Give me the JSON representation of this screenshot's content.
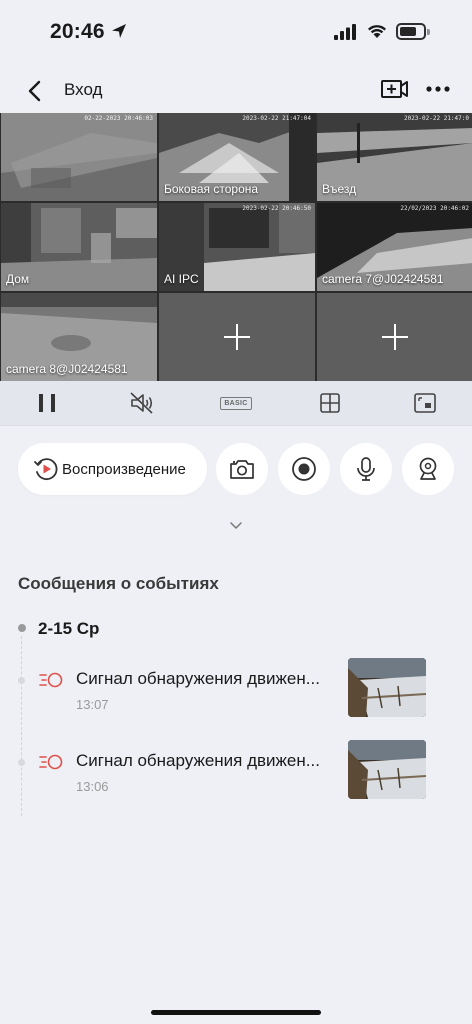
{
  "status_bar": {
    "time": "20:46"
  },
  "nav": {
    "title": "Вход"
  },
  "cameras": [
    {
      "label": "",
      "timestamp": "02-22-2023 20:46:03",
      "selected": true
    },
    {
      "label": "Боковая сторона",
      "timestamp": "2023-02-22 21:47:04"
    },
    {
      "label": "Въезд",
      "timestamp": "2023-02-22 21:47:0"
    },
    {
      "label": "Дом",
      "timestamp": ""
    },
    {
      "label": "AI IPC",
      "timestamp": "2023-02-22 20:46:50"
    },
    {
      "label": "camera 7@J02424581",
      "timestamp": "22/02/2023 20:46:02"
    },
    {
      "label": "camera 8@J02424581",
      "timestamp": ""
    }
  ],
  "controls": {
    "basic_label": "BASIC"
  },
  "actions": {
    "playback_label": "Воспроизведение"
  },
  "events": {
    "section_title": "Сообщения о событиях",
    "date": "2-15 Ср",
    "items": [
      {
        "title": "Сигнал обнаружения движен...",
        "time": "13:07"
      },
      {
        "title": "Сигнал обнаружения движен...",
        "time": "13:06"
      }
    ]
  },
  "colors": {
    "accent_red": "#e0504a",
    "background": "#eef0f6",
    "selected_outline": "#d53a3a"
  }
}
